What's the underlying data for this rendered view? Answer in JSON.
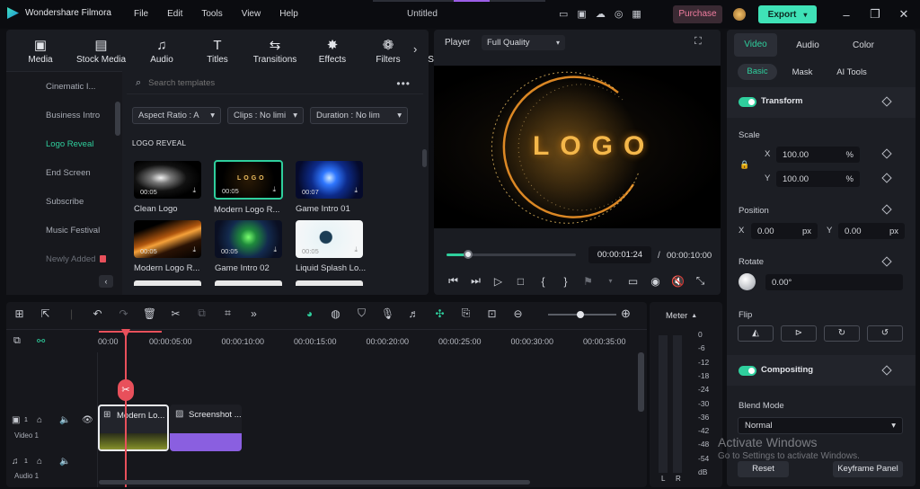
{
  "titlebar": {
    "app_name": "Wondershare Filmora",
    "menus": [
      "File",
      "Edit",
      "Tools",
      "View",
      "Help"
    ],
    "project_title": "Untitled",
    "purchase_label": "Purchase",
    "export_label": "Export"
  },
  "media_tabs": [
    {
      "label": "Media",
      "icon": "media-icon",
      "glyph": "▣"
    },
    {
      "label": "Stock Media",
      "icon": "stock-media-icon",
      "glyph": "▤"
    },
    {
      "label": "Audio",
      "icon": "audio-icon",
      "glyph": "♫"
    },
    {
      "label": "Titles",
      "icon": "titles-icon",
      "glyph": "T"
    },
    {
      "label": "Transitions",
      "icon": "transitions-icon",
      "glyph": "⇆"
    },
    {
      "label": "Effects",
      "icon": "effects-icon",
      "glyph": "✸"
    },
    {
      "label": "Filters",
      "icon": "filters-icon",
      "glyph": "❁"
    },
    {
      "label": "Stickers",
      "icon": "stickers-icon",
      "glyph": "✈"
    }
  ],
  "sidebar": {
    "items": [
      "Cinematic I...",
      "Business Intro",
      "Logo Reveal",
      "End Screen",
      "Subscribe",
      "Music Festival",
      "Newly Added"
    ],
    "active_index": 2
  },
  "templates": {
    "search_placeholder": "Search templates",
    "filters": [
      "Aspect Ratio : A",
      "Clips : No limi",
      "Duration : No lim"
    ],
    "section_title": "LOGO REVEAL",
    "items": [
      {
        "name": "Clean Logo",
        "duration": "00:05"
      },
      {
        "name": "Modern Logo R...",
        "duration": "00:05",
        "thumb_text": "LOGO"
      },
      {
        "name": "Game Intro 01",
        "duration": "00:07"
      },
      {
        "name": "Modern Logo R...",
        "duration": "00:05"
      },
      {
        "name": "Game Intro 02",
        "duration": "00:05"
      },
      {
        "name": "Liquid Splash Lo...",
        "duration": "00:05"
      }
    ]
  },
  "player": {
    "label": "Player",
    "quality": "Full Quality",
    "logo_text": "LOGO",
    "current_time": "00:00:01:24",
    "separator": "/",
    "total_time": "00:00:10:00",
    "progress": 0.15
  },
  "properties": {
    "tabs": [
      "Video",
      "Audio",
      "Color"
    ],
    "subtabs": [
      "Basic",
      "Mask",
      "AI Tools"
    ],
    "transform_label": "Transform",
    "scale_label": "Scale",
    "scale_x_axis": "X",
    "scale_x": "100.00",
    "scale_y_axis": "Y",
    "scale_y": "100.00",
    "percent": "%",
    "position_label": "Position",
    "pos_x_axis": "X",
    "pos_x": "0.00",
    "pos_y_axis": "Y",
    "pos_y": "0.00",
    "px": "px",
    "rotate_label": "Rotate",
    "rotate_value": "0.00°",
    "flip_label": "Flip",
    "compositing_label": "Compositing",
    "blend_label": "Blend Mode",
    "blend_value": "Normal",
    "reset_label": "Reset",
    "keyframe_label": "Keyframe Panel"
  },
  "timeline": {
    "ruler": [
      "00:00",
      "00:00:05:00",
      "00:00:10:00",
      "00:00:15:00",
      "00:00:20:00",
      "00:00:25:00",
      "00:00:30:00",
      "00:00:35:00"
    ],
    "clips": [
      "Modern Lo...",
      "Screenshot ..."
    ],
    "video_track": "Video 1",
    "audio_track": "Audio 1",
    "video_track_num": "1",
    "audio_track_num": "1"
  },
  "meter": {
    "label": "Meter",
    "scale": [
      "0",
      "-6",
      "-12",
      "-18",
      "-24",
      "-30",
      "-36",
      "-42",
      "-48",
      "-54",
      "dB"
    ],
    "channels": [
      "L",
      "R"
    ]
  },
  "watermark": {
    "line1": "Activate Windows",
    "line2": "Go to Settings to activate Windows."
  },
  "colors": {
    "accent": "#2fcf9d",
    "purchase": "#e46a8a",
    "clip_video": "#8a5fe0"
  }
}
